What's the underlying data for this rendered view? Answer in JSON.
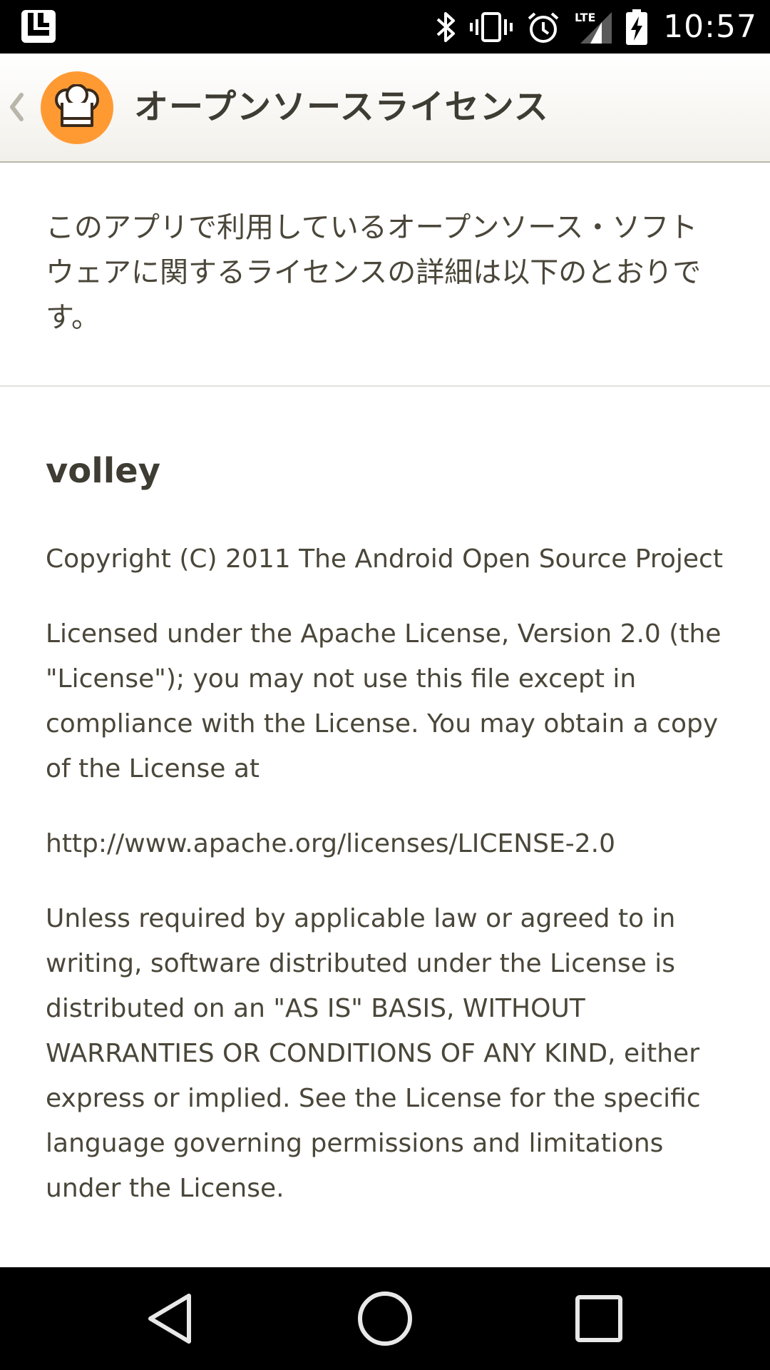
{
  "status_bar": {
    "time": "10:57",
    "network_label": "LTE",
    "icons": [
      "launcher-icon",
      "bluetooth-icon",
      "vibrate-icon",
      "alarm-icon",
      "lte-signal-icon",
      "battery-charging-icon"
    ]
  },
  "app_bar": {
    "title": "オープンソースライセンス",
    "logo_icon": "chef-hat-icon",
    "back_icon": "chevron-left-icon"
  },
  "intro": {
    "text": "このアプリで利用しているオープンソース・ソフトウェアに関するライセンスの詳細は以下のとおりです。"
  },
  "license": {
    "name": "volley",
    "paragraphs": [
      "Copyright (C) 2011 The Android Open Source Project",
      "Licensed under the Apache License, Version 2.0 (the \"License\"); you may not use this file except in compliance with the License. You may obtain a copy of the License at",
      "http://www.apache.org/licenses/LICENSE-2.0",
      "Unless required by applicable law or agreed to in writing, software distributed under the License is distributed on an \"AS IS\" BASIS, WITHOUT WARRANTIES OR CONDITIONS OF ANY KIND, either express or implied. See the License for the specific language governing permissions and limitations under the License."
    ]
  },
  "nav_bar": {
    "icons": [
      "back-triangle-icon",
      "home-circle-icon",
      "recents-square-icon"
    ]
  },
  "colors": {
    "status_bar_bg": "#000000",
    "app_bar_bg": "#f2f0ea",
    "logo_orange": "#ff9a33",
    "text": "#4a4639",
    "divider": "#e3e1da"
  }
}
